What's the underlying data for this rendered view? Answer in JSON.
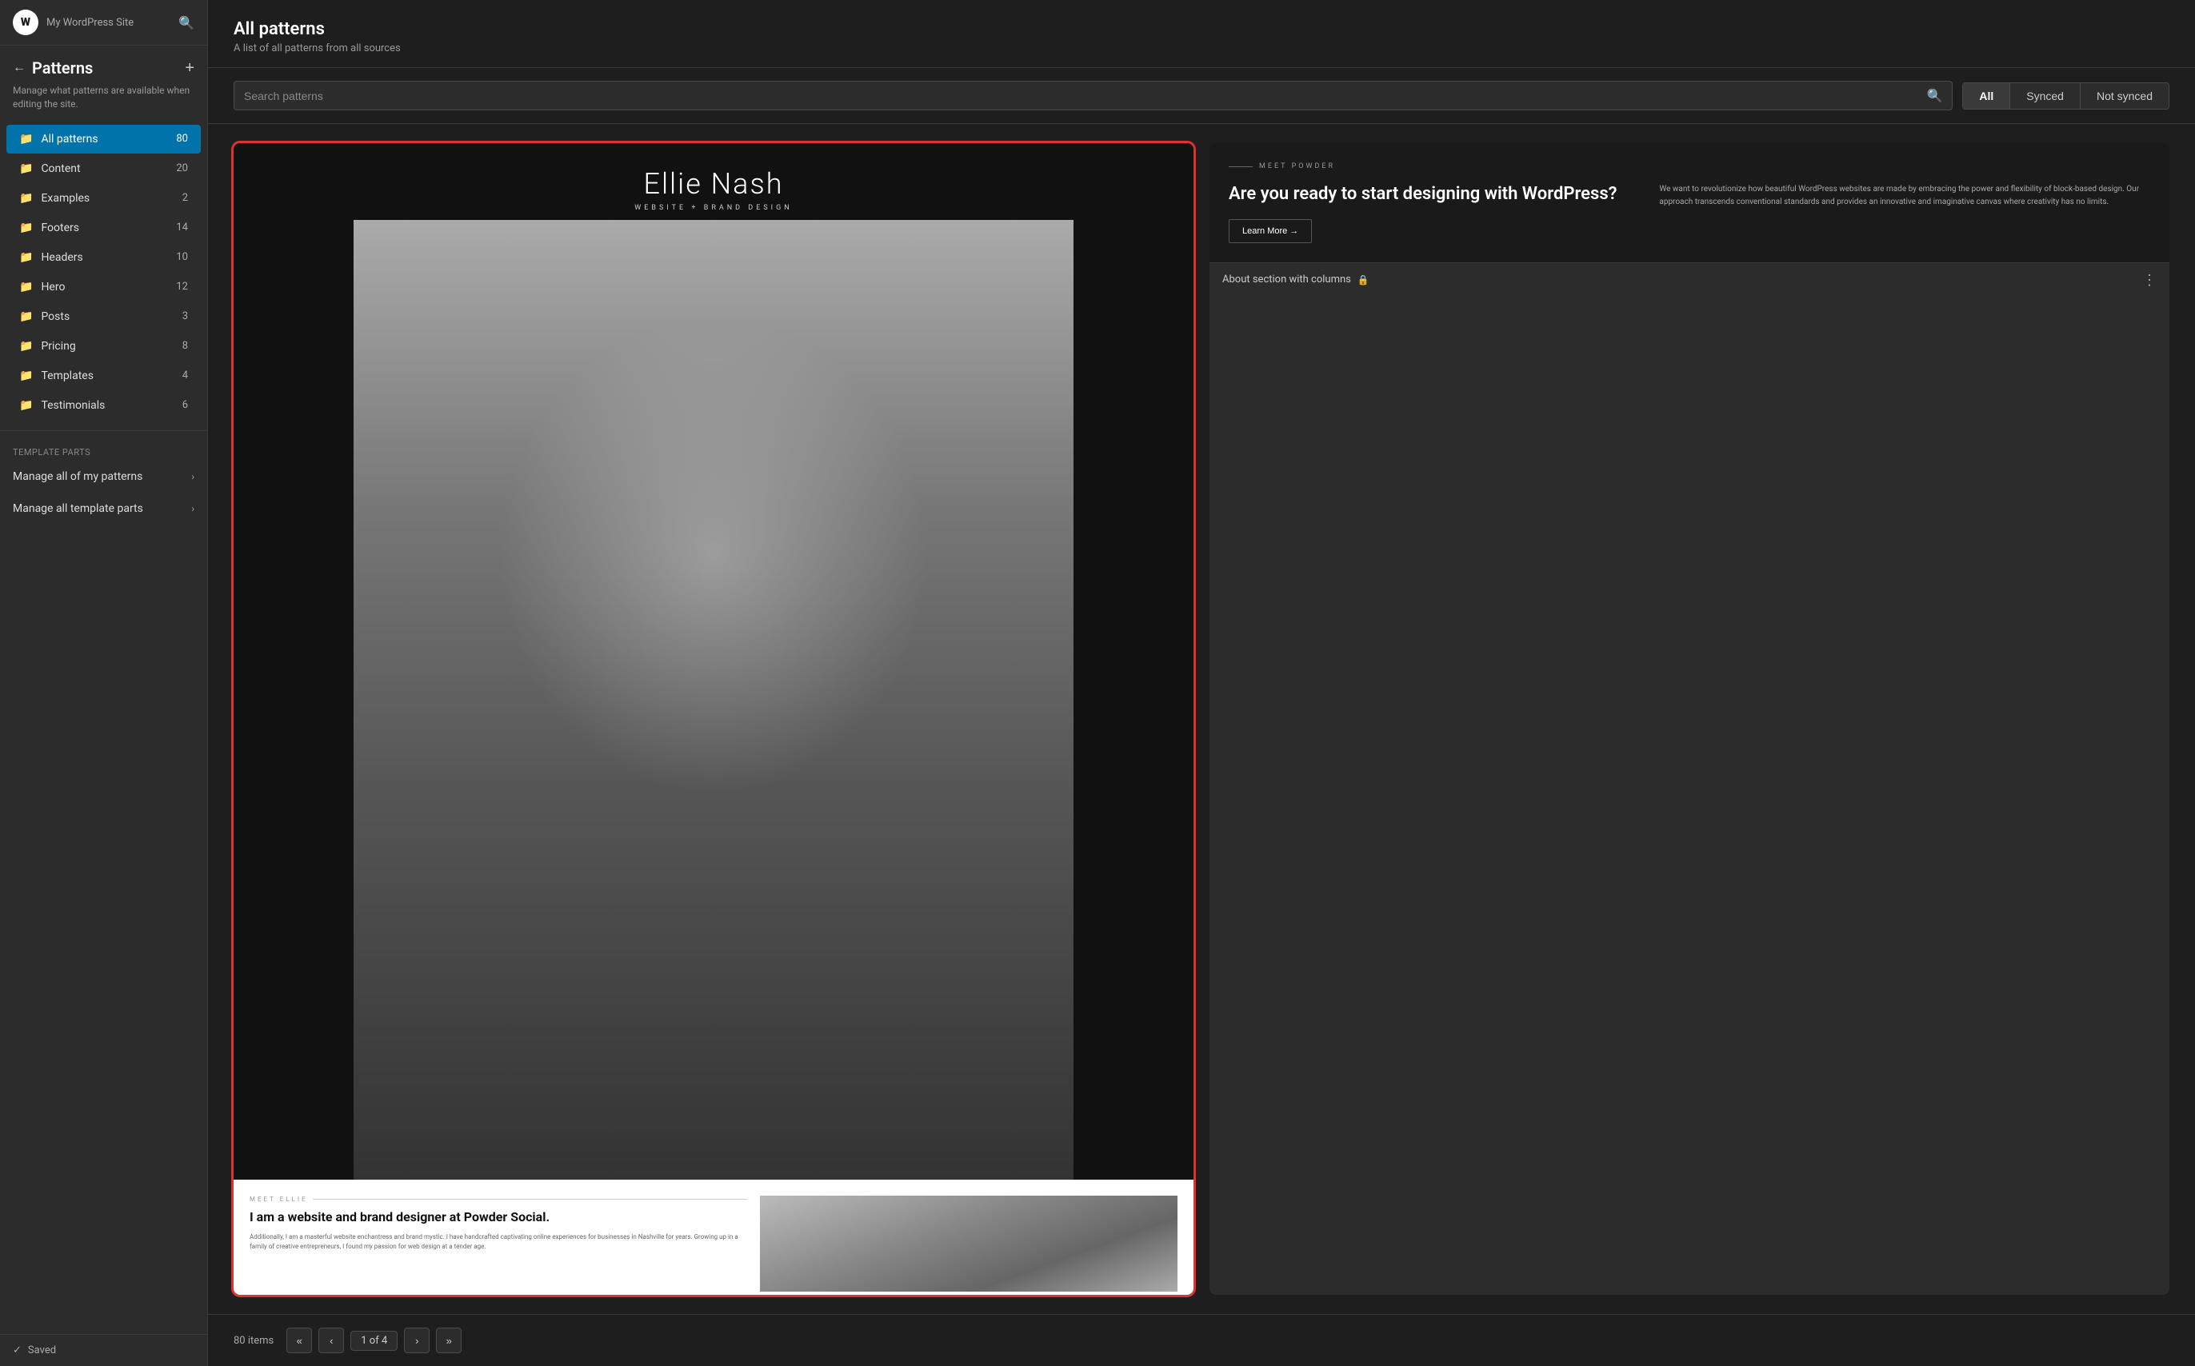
{
  "sidebar": {
    "wp_logo": "W",
    "site_name": "My WordPress Site",
    "back_label": "←",
    "title": "Patterns",
    "add_label": "+",
    "description": "Manage what patterns are available when editing the site.",
    "nav_items": [
      {
        "id": "all-patterns",
        "label": "All patterns",
        "count": "80",
        "active": true
      },
      {
        "id": "content",
        "label": "Content",
        "count": "20",
        "active": false
      },
      {
        "id": "examples",
        "label": "Examples",
        "count": "2",
        "active": false
      },
      {
        "id": "footers",
        "label": "Footers",
        "count": "14",
        "active": false
      },
      {
        "id": "headers",
        "label": "Headers",
        "count": "10",
        "active": false
      },
      {
        "id": "hero",
        "label": "Hero",
        "count": "12",
        "active": false
      },
      {
        "id": "posts",
        "label": "Posts",
        "count": "3",
        "active": false
      },
      {
        "id": "pricing",
        "label": "Pricing",
        "count": "8",
        "active": false
      },
      {
        "id": "templates",
        "label": "Templates",
        "count": "4",
        "active": false
      },
      {
        "id": "testimonials",
        "label": "Testimonials",
        "count": "6",
        "active": false
      }
    ],
    "section_label": "TEMPLATE PARTS",
    "manage_patterns": "Manage all of my patterns",
    "manage_templates": "Manage all template parts",
    "saved_status": "Saved"
  },
  "header": {
    "title": "All patterns",
    "subtitle": "A list of all patterns from all sources"
  },
  "search": {
    "placeholder": "Search patterns"
  },
  "filter_tabs": [
    {
      "id": "all",
      "label": "All",
      "active": true
    },
    {
      "id": "synced",
      "label": "Synced",
      "active": false
    },
    {
      "id": "not-synced",
      "label": "Not synced",
      "active": false
    }
  ],
  "patterns": [
    {
      "id": "ellie-nash",
      "selected": true,
      "ellie": {
        "name": "Ellie Nash",
        "tagline": "WEBSITE + BRAND DESIGN",
        "meet_label": "MEET ELLIE",
        "headline": "I am a website and brand designer at Powder Social.",
        "body": "Additionally, I am a masterful website enchantress and brand mystic. I have handcrafted captivating online experiences for businesses in Nashville for years. Growing up in a family of creative entrepreneurs, I found my passion for web design at a tender age."
      }
    },
    {
      "id": "about-section",
      "selected": false,
      "label": "About section with columns",
      "locked": true,
      "about": {
        "meet_label": "MEET POWDER",
        "heading": "Are you ready to start designing with WordPress?",
        "body": "We want to revolutionize how beautiful WordPress websites are made by embracing the power and flexibility of block-based design. Our approach transcends conventional standards and provides an innovative and imaginative canvas where creativity has no limits.",
        "learn_more": "Learn More →"
      }
    }
  ],
  "pagination": {
    "items_count": "80 items",
    "first": "«",
    "prev": "‹",
    "current": "1 of 4",
    "next": "›",
    "last": "»"
  }
}
